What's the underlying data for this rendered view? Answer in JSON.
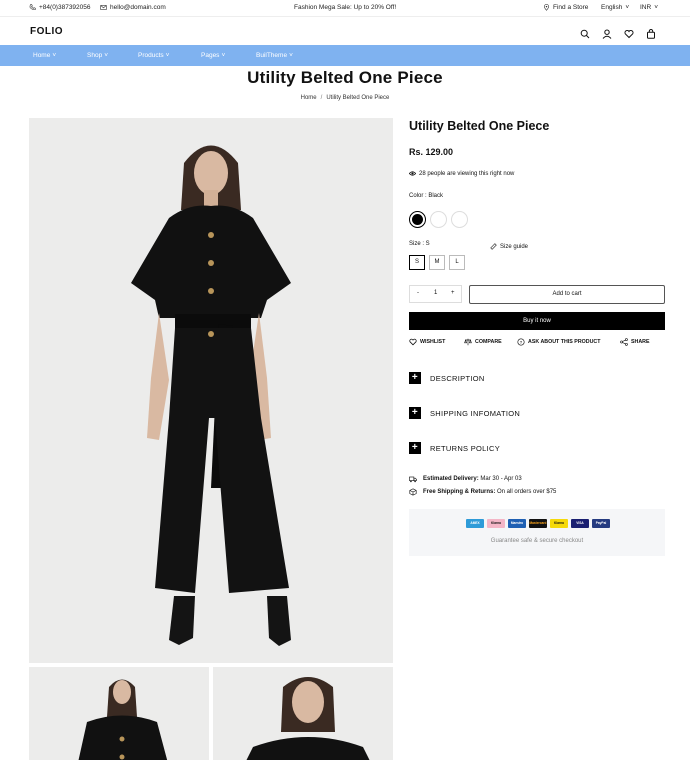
{
  "topbar": {
    "phone": "+84(0)387392056",
    "email": "hello@domain.com",
    "promo": "Fashion Mega Sale: Up to 20% Off!",
    "find_store": "Find a Store",
    "language": "English",
    "currency": "INR"
  },
  "header": {
    "logo": "FOLIO",
    "icons": [
      "search-icon",
      "user-icon",
      "heart-icon",
      "bag-icon"
    ]
  },
  "nav": {
    "items": [
      {
        "label": "Home"
      },
      {
        "label": "Shop"
      },
      {
        "label": "Products"
      },
      {
        "label": "Pages"
      },
      {
        "label": "BuilTheme"
      }
    ],
    "bg_color": "#7fb2f0"
  },
  "page": {
    "title": "Utility Belted One Piece",
    "breadcrumb": [
      "Home",
      "Utility Belted One Piece"
    ]
  },
  "product": {
    "title": "Utility Belted One Piece",
    "price": "Rs. 129.00",
    "viewing": "28 people are viewing this right now",
    "color_label": "Color : Black",
    "colors": [
      "#000000",
      "#ffffff",
      "#ffffff"
    ],
    "size_label": "Size : S",
    "size_guide": "Size guide",
    "sizes": [
      "S",
      "M",
      "L"
    ],
    "qty_minus": "-",
    "qty": "1",
    "qty_plus": "+",
    "add_to_cart": "Add to cart",
    "buy_now": "Buy it now",
    "actions": {
      "wishlist": "WISHLIST",
      "compare": "COMPARE",
      "ask": "ASK ABOUT THIS PRODUCT",
      "share": "SHARE"
    },
    "accordions": [
      "DESCRIPTION",
      "SHIPPING INFOMATION",
      "RETURNS POLICY"
    ],
    "delivery_label": "Estimated Delivery:",
    "delivery_value": "Mar 30 - Apr 03",
    "shipping_label": "Free Shipping & Returns:",
    "shipping_value": "On all orders over $75",
    "payment_methods": [
      "AMEX",
      "Klarna",
      "Maestro",
      "Mastercard",
      "Klarna",
      "VISA",
      "PayPal"
    ],
    "secure_text": "Guarantee safe & secure checkout"
  }
}
